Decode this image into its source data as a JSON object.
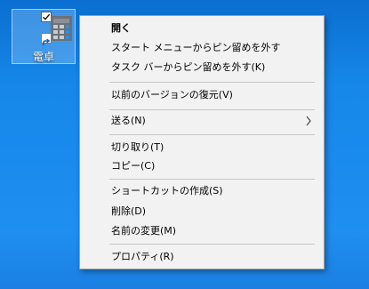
{
  "desktop": {
    "background_color": "#1a88ea",
    "icon": {
      "label": "電卓",
      "icon_name": "calculator-app-icon"
    }
  },
  "context_menu": {
    "items": [
      {
        "label": "開く",
        "bold": true
      },
      {
        "label": "スタート メニューからピン留めを外す"
      },
      {
        "label": "タスク バーからピン留めを外す(K)"
      },
      {
        "label": "以前のバージョンの復元(V)"
      },
      {
        "label": "送る(N)",
        "submenu": true
      },
      {
        "label": "切り取り(T)"
      },
      {
        "label": "コピー(C)"
      },
      {
        "label": "ショートカットの作成(S)"
      },
      {
        "label": "削除(D)"
      },
      {
        "label": "名前の変更(M)"
      },
      {
        "label": "プロパティ(R)"
      }
    ]
  }
}
